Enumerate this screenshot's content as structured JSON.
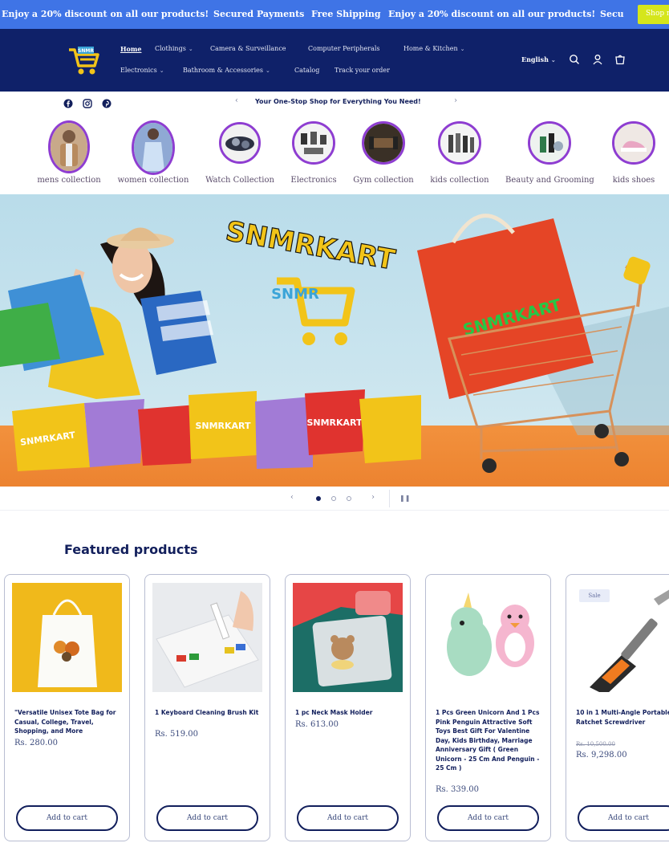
{
  "announcement": {
    "messages": [
      "Enjoy a 20% discount on all our products!",
      "Secured Payments",
      "Free Shipping",
      "Enjoy a 20% discount on all our products!",
      "Secu"
    ],
    "shop_button": "Shop n"
  },
  "header": {
    "logo_text": "SNMR",
    "nav": [
      {
        "label": "Home",
        "active": true
      },
      {
        "label": "Clothings",
        "dropdown": true
      },
      {
        "label": "Camera & Surveillance"
      },
      {
        "label": "Computer Peripherals"
      },
      {
        "label": "Home & Kitchen",
        "dropdown": true
      },
      {
        "label": "Electronics",
        "dropdown": true
      },
      {
        "label": "Bathroom & Accessories",
        "dropdown": true
      },
      {
        "label": "Catalog"
      },
      {
        "label": "Track your order"
      }
    ],
    "language": "English",
    "icons": [
      "search-icon",
      "account-icon",
      "cart-icon"
    ]
  },
  "strip": {
    "social": [
      "facebook-icon",
      "instagram-icon",
      "pinterest-icon"
    ],
    "tagline": "Your One-Stop Shop for Everything You Need!"
  },
  "collections": [
    {
      "label": "mens collection"
    },
    {
      "label": "women collection"
    },
    {
      "label": "Watch Collection"
    },
    {
      "label": "Electronics"
    },
    {
      "label": "Gym collection"
    },
    {
      "label": "kids collection"
    },
    {
      "label": "Beauty and Grooming"
    },
    {
      "label": "kids shoes"
    }
  ],
  "hero": {
    "brand_text": "SNMRKART",
    "logo_text": "SNMR",
    "bag_text": "SNMRKART",
    "small_bag_texts": [
      "SNMRKART",
      "SNMRKART",
      "SNMRKART"
    ],
    "slide_count": 3,
    "active_slide": 1
  },
  "featured": {
    "title": "Featured products",
    "products": [
      {
        "name": "\"Versatile Unisex Tote Bag for Casual, College, Travel, Shopping, and More",
        "price": "Rs. 280.00",
        "cart": "Add to cart"
      },
      {
        "name": "1 Keyboard Cleaning Brush Kit",
        "price": "Rs. 519.00",
        "cart": "Add to cart"
      },
      {
        "name": "1 pc Neck Mask Holder",
        "price": "Rs. 613.00",
        "cart": "Add to cart"
      },
      {
        "name": "1 Pcs Green Unicorn And 1 Pcs Pink Penguin Attractive Soft Toys Best Gift For Valentine Day, Kids Birthday, Marriage Anniversary Gift ( Green Unicorn - 25 Cm And Penguin - 25 Cm )",
        "price": "Rs. 339.00",
        "cart": "Add to cart"
      },
      {
        "name": "10 in 1 Multi-Angle Portable Ratchet Screwdriver",
        "old_price": "Rs. 10,500.00",
        "price": "Rs. 9,298.00",
        "badge": "Sale",
        "cart": "Add to cart"
      }
    ]
  },
  "colors": {
    "announcement_bg": "#3f74e6",
    "header_bg": "#0f2169",
    "accent_purple": "#8e3dd1",
    "text_navy": "#121f5c"
  }
}
